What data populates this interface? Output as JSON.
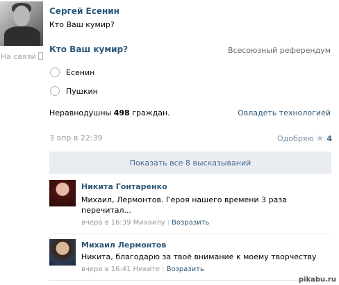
{
  "post": {
    "author": "Сергей Есенин",
    "text": "Кто Ваш кумир?",
    "online_status": "На связи"
  },
  "poll": {
    "question": "Кто Ваш кумир?",
    "type": "Всесоюзный референдум",
    "options": [
      "Есенин",
      "Пушкин"
    ],
    "voted_prefix": "Неравнодушны",
    "voted_count": "498",
    "voted_suffix": "граждан.",
    "tech_link": "Овладеть технологией"
  },
  "meta": {
    "date": "3 апр в 22:39",
    "like_label": "Одобряю",
    "like_count": "4"
  },
  "show_all": "Показать все 8 высказываний",
  "comments": [
    {
      "author": "Никита Гонтаренко",
      "text_line1": "Михаил, Лермонтов. Героя нашего времени 3 раза",
      "text_line2": "перечитал...",
      "time": "вчера в 16:39 Михаилу",
      "reply": "Возразить"
    },
    {
      "author": "Михаил Лермонтов",
      "text_line1": "Никита, благодарю за твоё внимание к моему творчеству",
      "time": "вчера в 16:41 Никите",
      "reply": "Возразить"
    }
  ],
  "watermark": "pikabu.ru",
  "colors": {
    "link": "#2b587a",
    "button_bg": "#e9edf1",
    "muted": "#999999"
  },
  "icons": [
    "phone-icon",
    "star-icon"
  ]
}
